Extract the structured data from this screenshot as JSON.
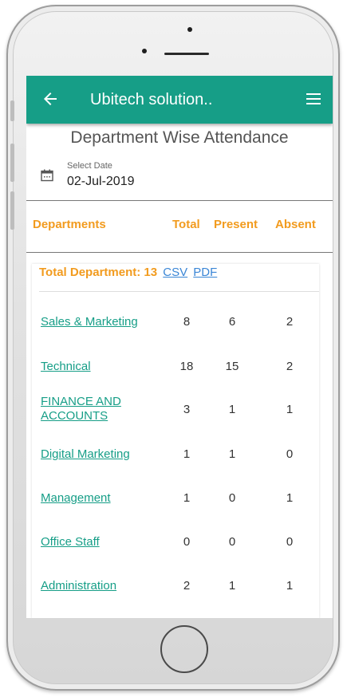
{
  "app_bar": {
    "title": "Ubitech solution..",
    "back_icon": "arrow-left-icon",
    "menu_icon": "hamburger-menu-icon",
    "color": "#169e87"
  },
  "page_title": "Department Wise Attendance",
  "date_picker": {
    "label": "Select Date",
    "value": "02-Jul-2019",
    "icon": "calendar-icon"
  },
  "table_header": {
    "departments": "Departments",
    "total": "Total",
    "present": "Present",
    "absent": "Absent",
    "color": "#f29b1e"
  },
  "summary": {
    "label": "Total Department: 13",
    "csv": "CSV",
    "pdf": "PDF"
  },
  "departments": [
    {
      "name": "Sales & Marketing",
      "total": "8",
      "present": "6",
      "absent": "2"
    },
    {
      "name": "Technical",
      "total": "18",
      "present": "15",
      "absent": "2"
    },
    {
      "name": "FINANCE AND ACCOUNTS",
      "total": "3",
      "present": "1",
      "absent": "1"
    },
    {
      "name": "Digital Marketing",
      "total": "1",
      "present": "1",
      "absent": "0"
    },
    {
      "name": "Management",
      "total": "1",
      "present": "0",
      "absent": "1"
    },
    {
      "name": "Office Staff",
      "total": "0",
      "present": "0",
      "absent": "0"
    },
    {
      "name": "Administration",
      "total": "2",
      "present": "1",
      "absent": "1"
    }
  ]
}
